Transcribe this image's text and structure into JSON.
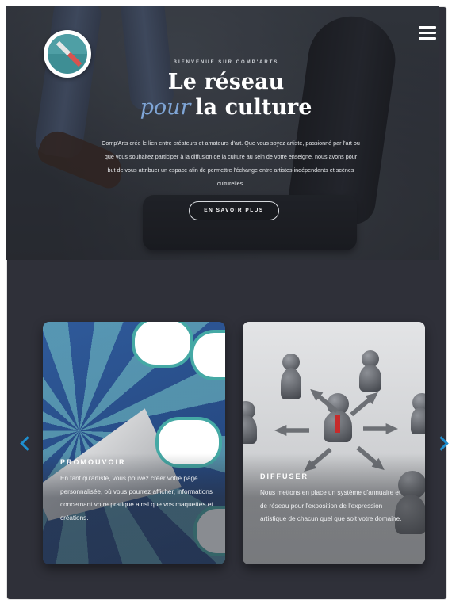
{
  "hero": {
    "eyebrow": "BIENVENUE SUR COMP'ARTS",
    "title_line1": "Le réseau",
    "title_pour": "pour",
    "title_line2_rest": "la culture",
    "description": "Comp'Arts crée le lien entre créateurs et amateurs d'art. Que vous soyez artiste, passionné par l'art ou que vous souhaitez participer à la diffusion de la culture au sein de votre enseigne, nous avons pour but de vous attribuer un espace afin de permettre l'échange entre artistes indépendants et scènes culturelles.",
    "cta_label": "EN SAVOIR PLUS"
  },
  "nav": {
    "menu_icon": "hamburger-menu-icon",
    "logo_icon": "compass-logo-icon"
  },
  "carousel": {
    "prev_icon": "chevron-left-icon",
    "next_icon": "chevron-right-icon",
    "cards": [
      {
        "title": "PROMOUVOIR",
        "text": "En tant qu'artiste, vous pouvez créer votre page personnalisée, où vous pourrez afficher, informations concernant votre pratique ainsi que vos maquettes et créations."
      },
      {
        "title": "DIFFUSER",
        "text": "Nous mettons en place un système d'annuaire et de réseau pour l'exposition de l'expression artistique de chacun quel que soit votre domaine."
      }
    ]
  },
  "colors": {
    "accent": "#1e8fd0",
    "pour": "#7fa5d6",
    "section_bg": "#2f3039"
  }
}
